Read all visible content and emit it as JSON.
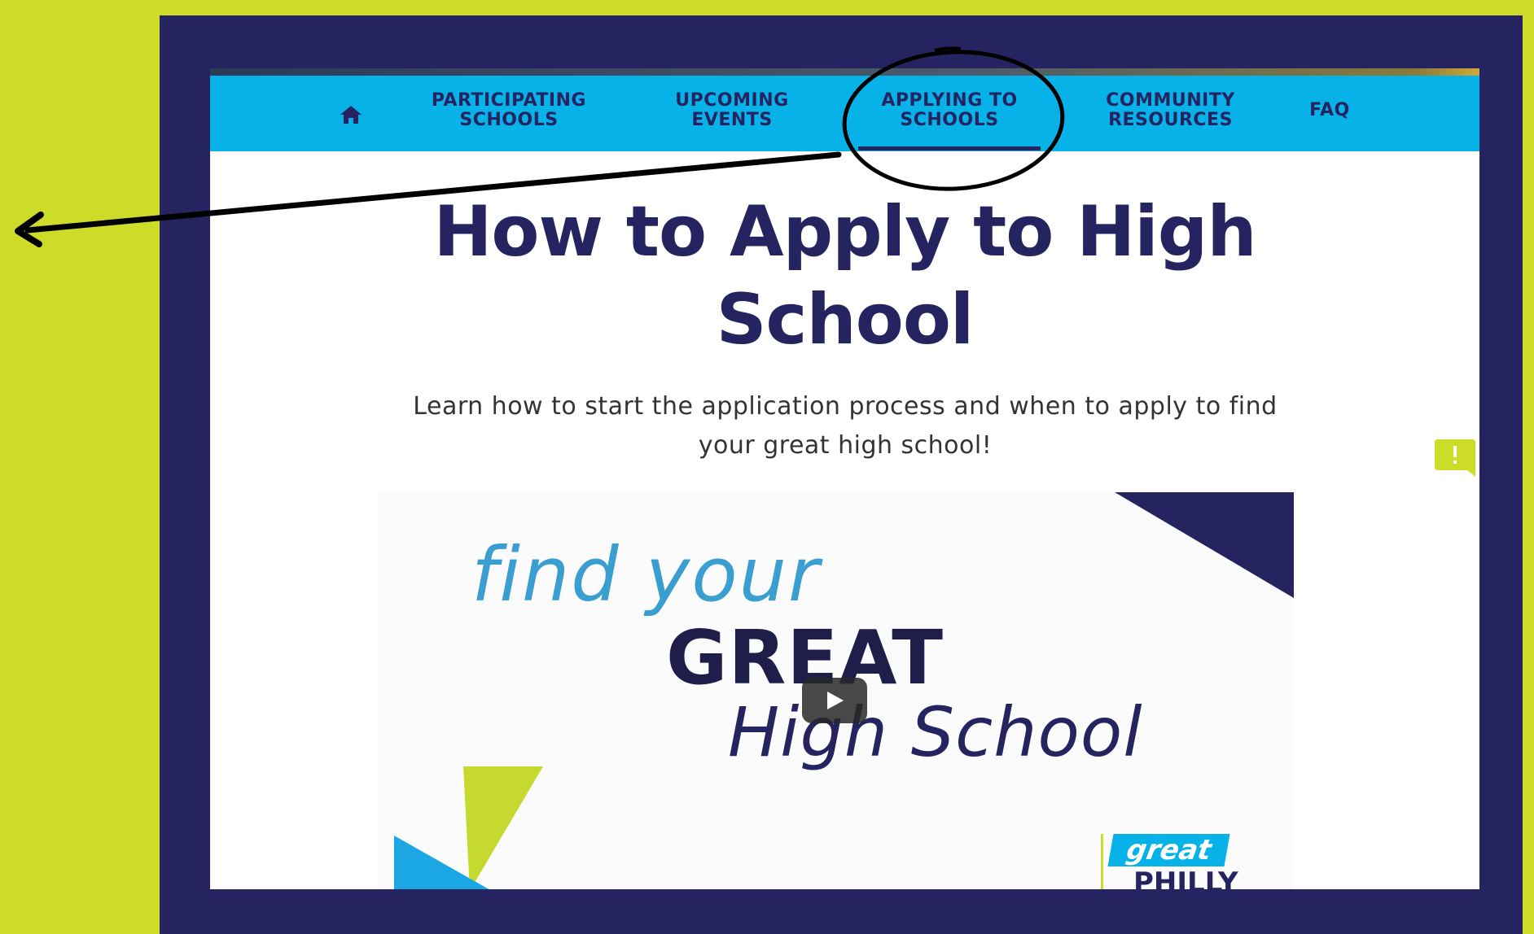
{
  "nav": {
    "items": [
      {
        "label_line1": "PARTICIPATING",
        "label_line2": "SCHOOLS"
      },
      {
        "label_line1": "UPCOMING",
        "label_line2": "EVENTS"
      },
      {
        "label_line1": "APPLYING TO",
        "label_line2": "SCHOOLS"
      },
      {
        "label_line1": "COMMUNITY",
        "label_line2": "RESOURCES"
      },
      {
        "label_line1": "FAQ",
        "label_line2": ""
      }
    ],
    "home_icon": "home-icon",
    "active_item": "APPLYING TO SCHOOLS"
  },
  "main": {
    "heading_line1": "How to Apply to High",
    "heading_line2": "School",
    "subtitle_line1": "Learn how to start the application process and when to apply to find",
    "subtitle_line2": "your great high school!"
  },
  "video": {
    "line1": "find your",
    "line2": "GREAT",
    "line3": "High School",
    "logo_top": "great",
    "logo_bottom": "PHILLY",
    "play_icon": "play-icon"
  },
  "colors": {
    "background": "#cddc29",
    "frame": "#262361",
    "nav": "#07b2e9",
    "heading": "#262361"
  },
  "feedback_icon": "feedback-icon"
}
